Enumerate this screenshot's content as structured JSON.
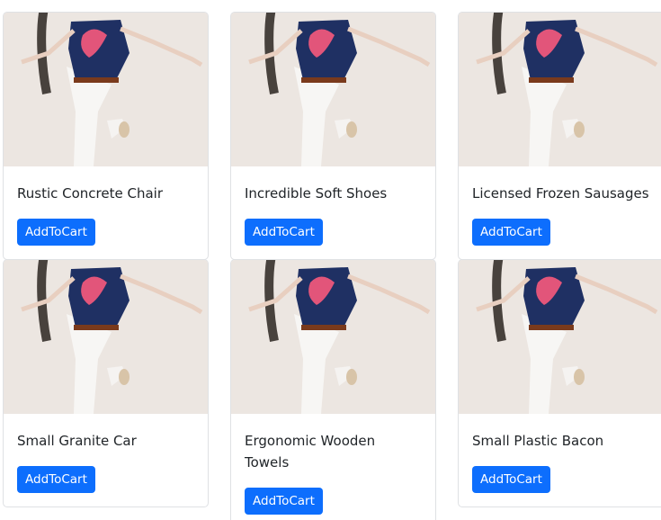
{
  "products": [
    {
      "name": "Rustic Concrete Chair",
      "button": "AddToCart"
    },
    {
      "name": "Incredible Soft Shoes",
      "button": "AddToCart"
    },
    {
      "name": "Licensed Frozen Sausages",
      "button": "AddToCart"
    },
    {
      "name": "Small Granite Car",
      "button": "AddToCart"
    },
    {
      "name": "Ergonomic Wooden Towels",
      "button": "AddToCart"
    },
    {
      "name": "Small Plastic Bacon",
      "button": "AddToCart"
    }
  ],
  "image": {
    "subject": "woman-jumping-photo"
  }
}
